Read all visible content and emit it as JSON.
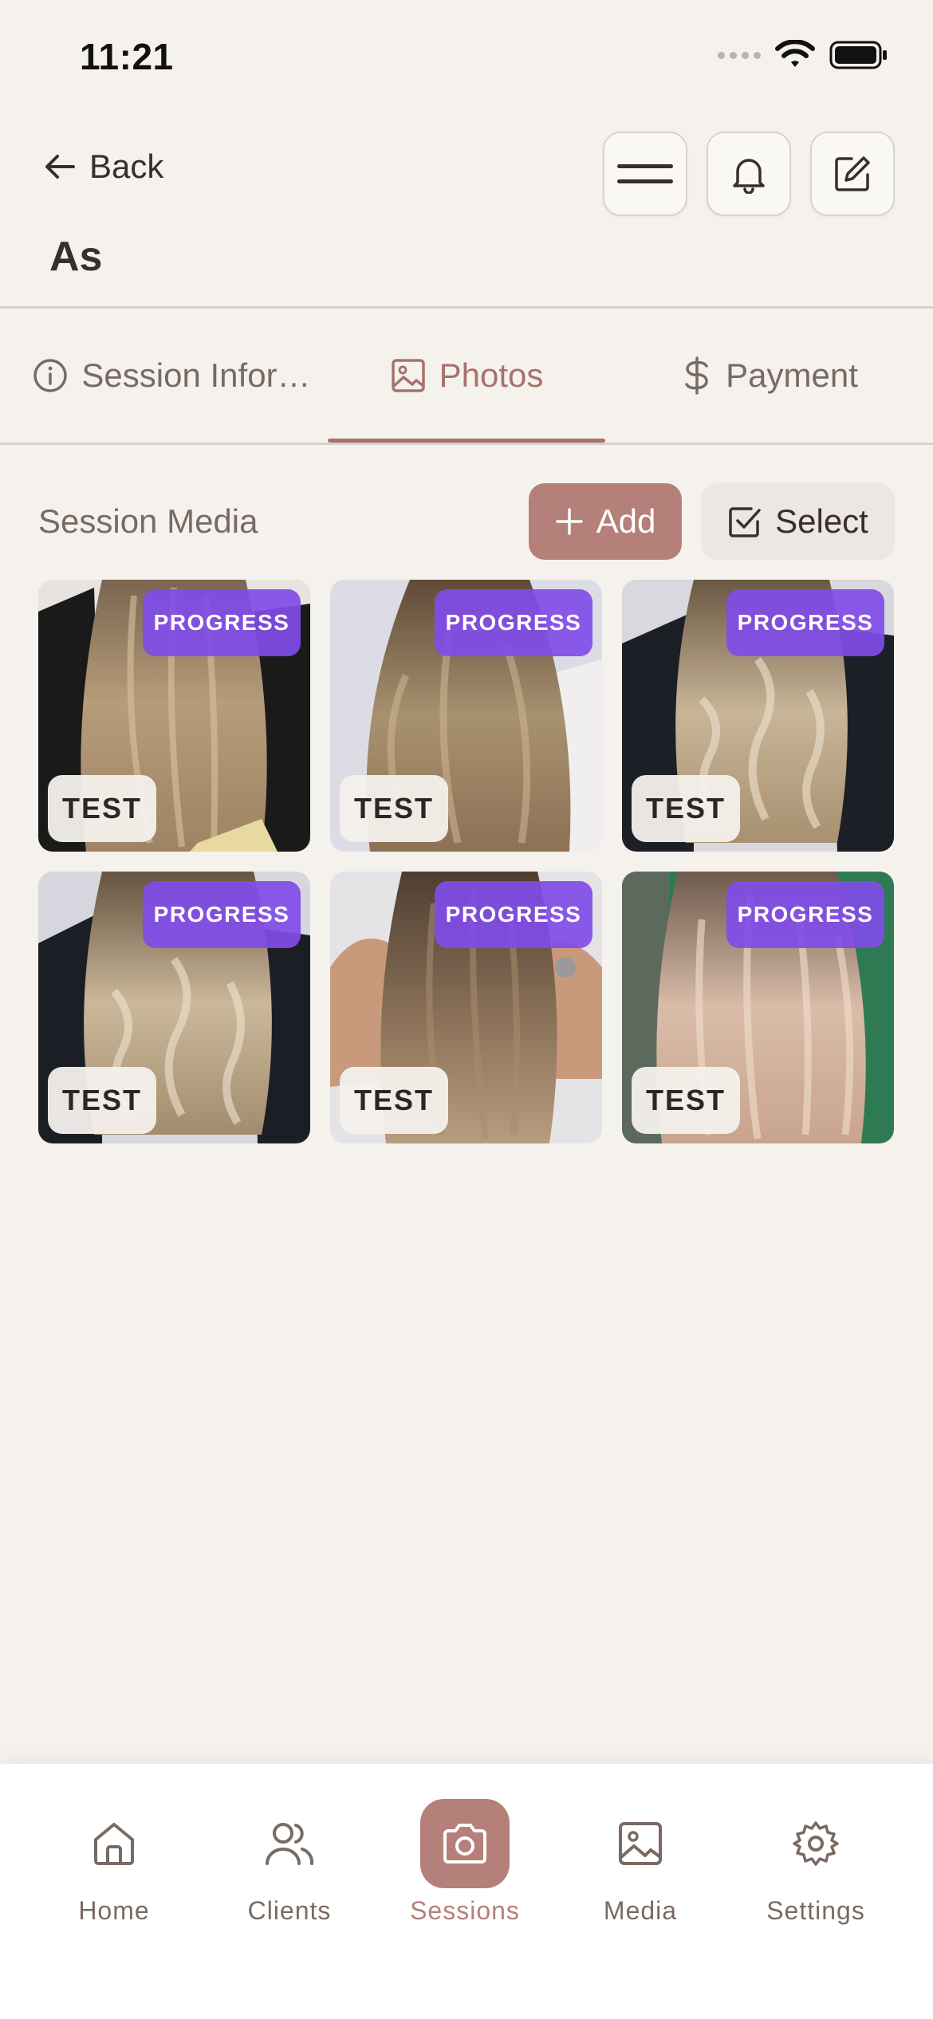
{
  "status_bar": {
    "time": "11:21"
  },
  "header": {
    "back_label": "Back",
    "title": "As",
    "actions": [
      "menu-icon",
      "bell-icon",
      "edit-icon"
    ]
  },
  "tabs": [
    {
      "label": "Session Infor…",
      "icon": "info-icon",
      "active": false
    },
    {
      "label": "Photos",
      "icon": "image-icon",
      "active": true
    },
    {
      "label": "Payment",
      "icon": "dollar-icon",
      "active": false
    }
  ],
  "media": {
    "section_title": "Session Media",
    "add_label": "Add",
    "select_label": "Select",
    "items": [
      {
        "tag": "PROGRESS",
        "label": "TEST"
      },
      {
        "tag": "PROGRESS",
        "label": "TEST"
      },
      {
        "tag": "PROGRESS",
        "label": "TEST"
      },
      {
        "tag": "PROGRESS",
        "label": "TEST"
      },
      {
        "tag": "PROGRESS",
        "label": "TEST"
      },
      {
        "tag": "PROGRESS",
        "label": "TEST"
      }
    ]
  },
  "bottom_nav": {
    "items": [
      {
        "label": "Home",
        "icon": "home-icon",
        "active": false
      },
      {
        "label": "Clients",
        "icon": "users-icon",
        "active": false
      },
      {
        "label": "Sessions",
        "icon": "camera-icon",
        "active": true
      },
      {
        "label": "Media",
        "icon": "image-icon",
        "active": false
      },
      {
        "label": "Settings",
        "icon": "gear-icon",
        "active": false
      }
    ]
  },
  "colors": {
    "background": "#F5F2EE",
    "accent": "#B5807A",
    "progress_badge": "#804CE8",
    "text": "#3A2E2A",
    "muted_text": "#7A6A64"
  }
}
